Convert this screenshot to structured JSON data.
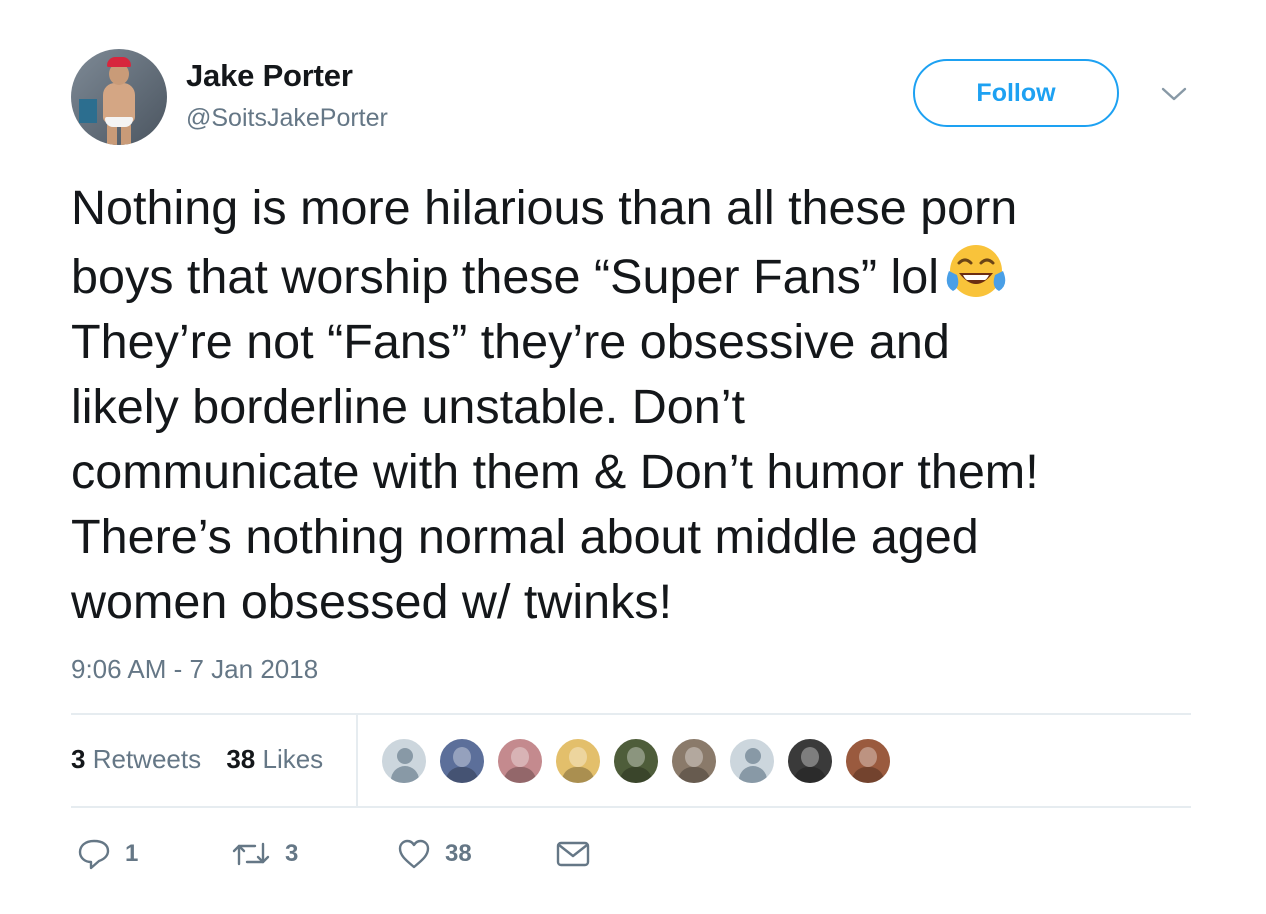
{
  "author": {
    "name": "Jake Porter",
    "handle": "@SoitsJakePorter"
  },
  "follow_label": "Follow",
  "tweet": {
    "lines": [
      "Nothing is more hilarious than all these porn",
      "boys that worship these “Super Fans” lol",
      "They’re not “Fans” they’re obsessive and",
      "likely borderline unstable. Don’t",
      "communicate with them & Don’t humor them!",
      "There’s nothing normal about middle aged",
      "women obsessed w/ twinks!"
    ],
    "emoji": "face-with-tears-of-joy",
    "timestamp": "9:06 AM - 7 Jan 2018"
  },
  "stats": {
    "retweets_count": "3",
    "retweets_label": "Retweets",
    "likes_count": "38",
    "likes_label": "Likes"
  },
  "likers": [
    {
      "kind": "default",
      "color": "#ccd6dd"
    },
    {
      "kind": "photo",
      "color": "#5c6f9a"
    },
    {
      "kind": "photo",
      "color": "#c48a8e"
    },
    {
      "kind": "photo",
      "color": "#e3bf6b"
    },
    {
      "kind": "photo",
      "color": "#4e5d3a"
    },
    {
      "kind": "photo",
      "color": "#8a7a6a"
    },
    {
      "kind": "default",
      "color": "#ccd6dd"
    },
    {
      "kind": "photo",
      "color": "#3a3a3a"
    },
    {
      "kind": "photo",
      "color": "#9a5a3e"
    }
  ],
  "actions": {
    "reply_count": "1",
    "retweet_count": "3",
    "like_count": "38"
  },
  "colors": {
    "accent": "#1da1f2",
    "muted": "#657786",
    "text": "#14171a",
    "divider": "#e6ecf0"
  }
}
